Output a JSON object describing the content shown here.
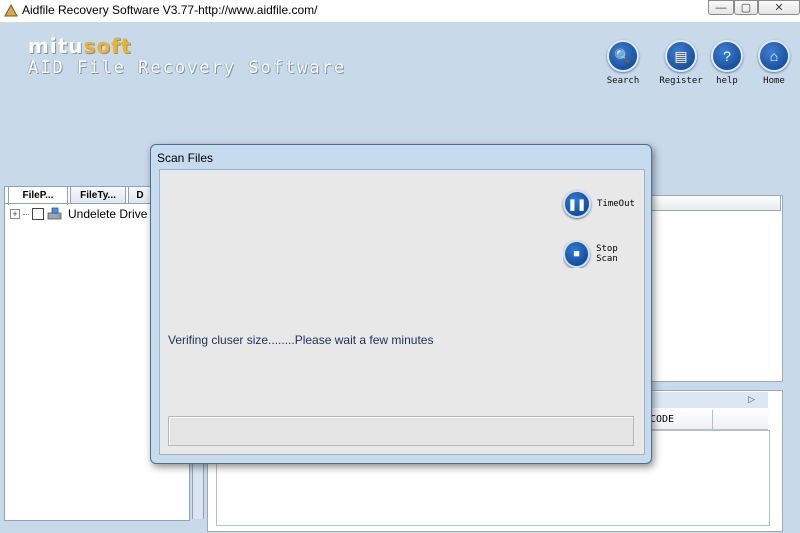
{
  "window": {
    "title": "Aidfile Recovery Software V3.77-http://www.aidfile.com/",
    "min_glyph": "—",
    "max_glyph": "▢",
    "close_glyph": "✕"
  },
  "header": {
    "logo_main": "mitu",
    "logo_accent": "soft",
    "product_name": "AID File Recovery Software"
  },
  "nav": [
    {
      "label": "Search",
      "icon": "search-icon",
      "glyph": "🔍"
    },
    {
      "label": "Register",
      "icon": "register-icon",
      "glyph": "▤"
    },
    {
      "label": "help",
      "icon": "help-icon",
      "glyph": "?"
    },
    {
      "label": "Home",
      "icon": "home-icon",
      "glyph": "⌂"
    }
  ],
  "left_panel": {
    "tabs": [
      "FileP...",
      "FileTy...",
      "D"
    ],
    "tree": [
      {
        "label": "Undelete Drive",
        "expander": "+",
        "checked": false
      }
    ]
  },
  "results": {
    "column_header": "CODE",
    "tab_arrow": "▷"
  },
  "dialog": {
    "title": "Scan Files",
    "message": "Verifing cluser size........Please wait a few minutes",
    "progress": 0,
    "actions": [
      {
        "label": "TimeOut",
        "icon": "pause-icon",
        "glyph": "❚❚"
      },
      {
        "label": "Stop Scan",
        "icon": "stop-icon",
        "glyph": "■"
      }
    ]
  },
  "colors": {
    "header_bg": "#c8d9ea",
    "dialog_frame": "#c7dbef",
    "dialog_body": "#e8e8e8",
    "button_blue": "#0e3f87",
    "logo_accent": "#f0b030"
  }
}
